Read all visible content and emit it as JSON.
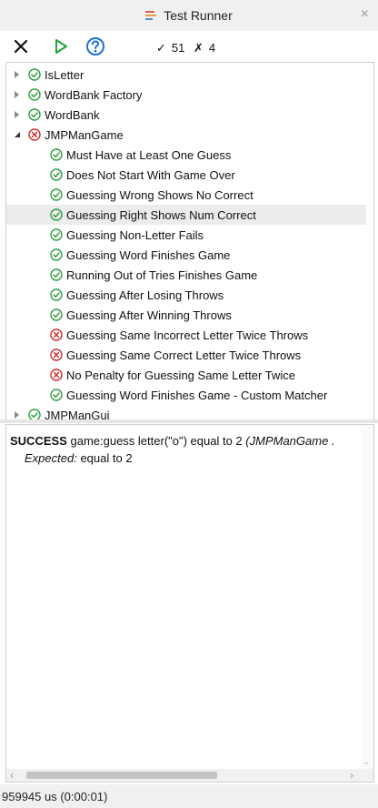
{
  "window": {
    "title": "Test Runner",
    "close_glyph": "×"
  },
  "toolbar": {
    "stop_icon": "close-x-icon",
    "run_icon": "play-icon",
    "help_icon": "help-icon",
    "passed_symbol": "✓",
    "passed_count": "51",
    "failed_symbol": "✗",
    "failed_count": "4"
  },
  "colors": {
    "pass": "#2e9e3f",
    "fail": "#d22b2b",
    "help": "#1e6fd0",
    "run": "#21a33a"
  },
  "tree": [
    {
      "label": "IsLetter",
      "status": "pass",
      "level": 0,
      "expander": "collapsed"
    },
    {
      "label": "WordBank Factory",
      "status": "pass",
      "level": 0,
      "expander": "collapsed"
    },
    {
      "label": "WordBank",
      "status": "pass",
      "level": 0,
      "expander": "collapsed"
    },
    {
      "label": "JMPManGame",
      "status": "fail",
      "level": 0,
      "expander": "expanded"
    },
    {
      "label": "Must Have at Least One Guess",
      "status": "pass",
      "level": 1
    },
    {
      "label": "Does Not Start With Game Over",
      "status": "pass",
      "level": 1
    },
    {
      "label": "Guessing Wrong Shows No Correct",
      "status": "pass",
      "level": 1
    },
    {
      "label": "Guessing Right Shows Num Correct",
      "status": "pass",
      "level": 1,
      "selected": true
    },
    {
      "label": "Guessing Non-Letter Fails",
      "status": "pass",
      "level": 1
    },
    {
      "label": "Guessing Word Finishes Game",
      "status": "pass",
      "level": 1
    },
    {
      "label": "Running Out of Tries Finishes Game",
      "status": "pass",
      "level": 1
    },
    {
      "label": "Guessing After Losing Throws",
      "status": "pass",
      "level": 1
    },
    {
      "label": "Guessing After Winning Throws",
      "status": "pass",
      "level": 1
    },
    {
      "label": "Guessing Same Incorrect Letter Twice Throws",
      "status": "fail",
      "level": 1
    },
    {
      "label": "Guessing Same Correct Letter Twice Throws",
      "status": "fail",
      "level": 1
    },
    {
      "label": "No Penalty for Guessing Same Letter Twice",
      "status": "fail",
      "level": 1
    },
    {
      "label": "Guessing Word Finishes Game - Custom Matcher",
      "status": "pass",
      "level": 1
    },
    {
      "label": "JMPManGui",
      "status": "pass",
      "level": 0,
      "expander": "collapsed"
    }
  ],
  "output": {
    "result": "SUCCESS",
    "message": "game:guess letter(\"o\") equal to 2",
    "context": "(JMPManGame .",
    "expected_label": "Expected:",
    "expected_value": "equal to 2"
  },
  "statusbar": {
    "text": "959945 us (0:00:01)"
  }
}
